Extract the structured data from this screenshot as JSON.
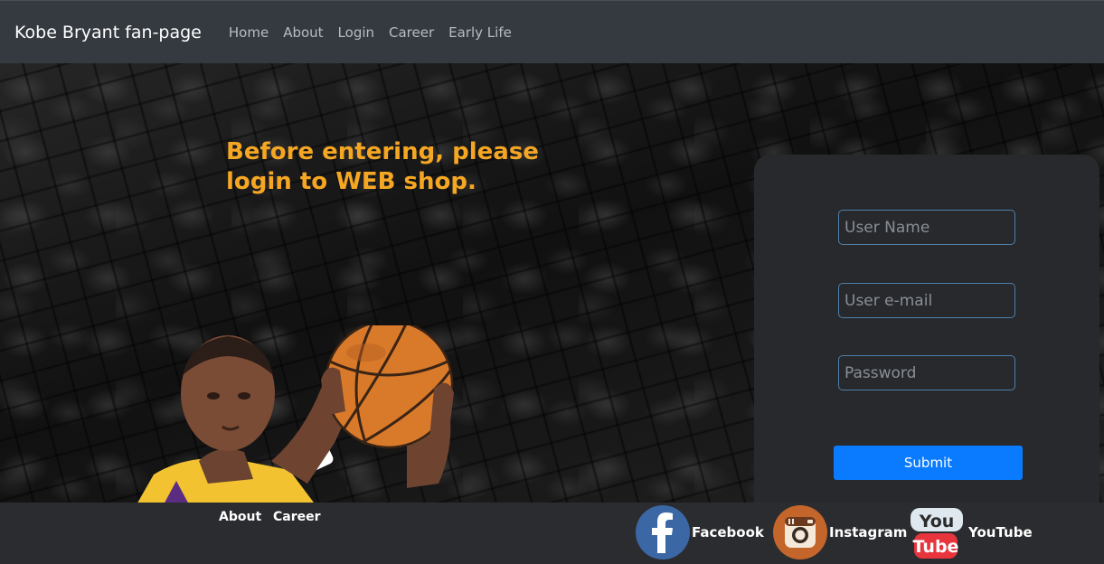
{
  "navbar": {
    "brand": "Kobe Bryant fan-page",
    "links": [
      "Home",
      "About",
      "Login",
      "Career",
      "Early Life"
    ]
  },
  "hero": {
    "headline": "Before entering, please login to WEB shop."
  },
  "login": {
    "username_placeholder": "User Name",
    "email_placeholder": "User e-mail",
    "password_placeholder": "Password",
    "submit_label": "Submit"
  },
  "footer": {
    "links": [
      "About",
      "Career"
    ],
    "social": [
      {
        "label": "Facebook",
        "icon": "facebook-icon"
      },
      {
        "label": "Instagram",
        "icon": "instagram-icon"
      },
      {
        "label": "YouTube",
        "icon": "youtube-icon"
      }
    ]
  },
  "colors": {
    "accent": "#f5a623",
    "button": "#0a7bff",
    "navbar": "#343a40",
    "card": "#27292d"
  }
}
